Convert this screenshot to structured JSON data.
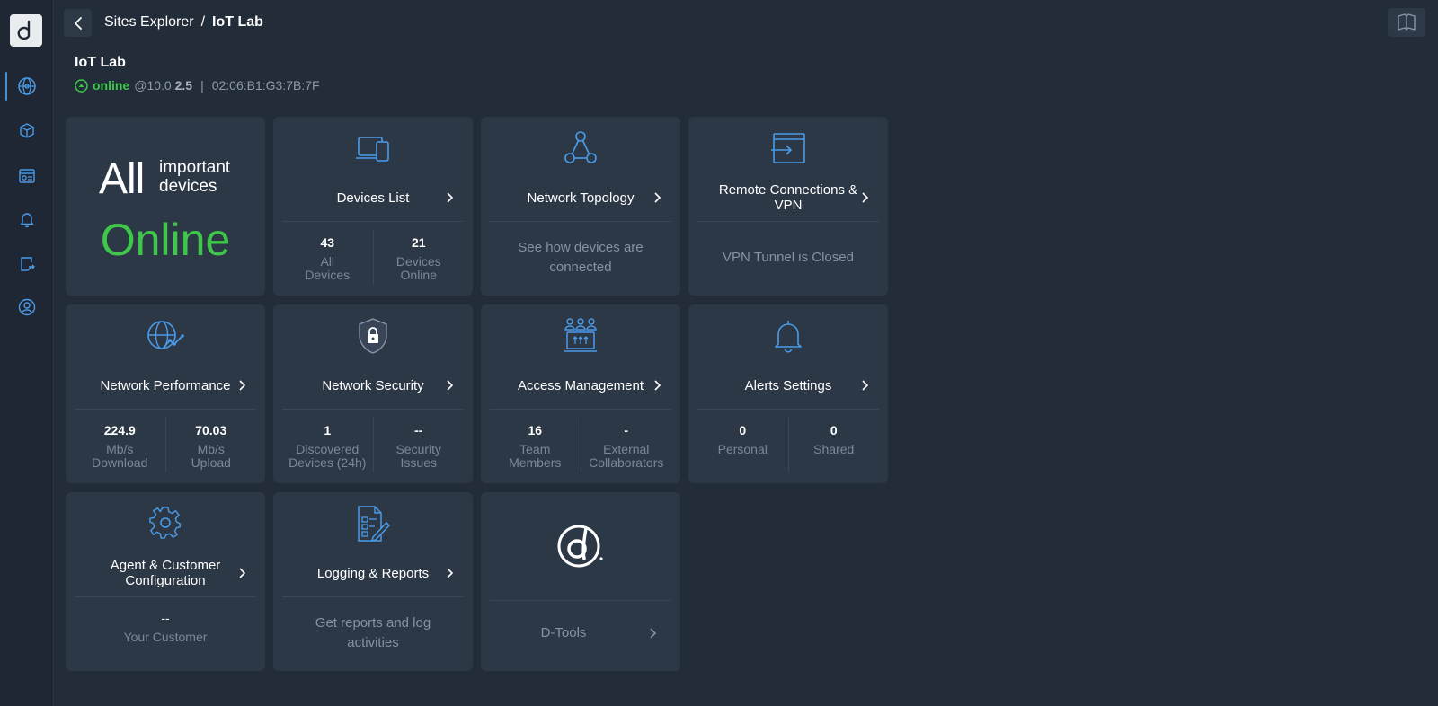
{
  "breadcrumb": {
    "parent": "Sites Explorer",
    "separator": "/",
    "current": "IoT Lab"
  },
  "site": {
    "title": "IoT Lab",
    "status": "online",
    "ip_prefix": "@10.0.",
    "ip_suffix": "2.5",
    "mac": "02:06:B1:G3:7B:7F"
  },
  "summary": {
    "big": "All",
    "small": "important devices",
    "state": "Online"
  },
  "cards": {
    "devices_list": {
      "label": "Devices List",
      "stat1_num": "43",
      "stat1_cap": "All Devices",
      "stat2_num": "21",
      "stat2_cap": "Devices Online"
    },
    "network_topology": {
      "label": "Network Topology",
      "desc": "See how devices are connected"
    },
    "remote_connections": {
      "label": "Remote Connections & VPN",
      "desc": "VPN Tunnel is Closed"
    },
    "network_performance": {
      "label": "Network Performance",
      "stat1_num": "224.9",
      "stat1_cap": "Mb/s Download",
      "stat2_num": "70.03",
      "stat2_cap": "Mb/s Upload"
    },
    "network_security": {
      "label": "Network Security",
      "stat1_num": "1",
      "stat1_cap": "Discovered Devices (24h)",
      "stat2_num": "--",
      "stat2_cap": "Security Issues"
    },
    "access_management": {
      "label": "Access Management",
      "stat1_num": "16",
      "stat1_cap": "Team Members",
      "stat2_num": "-",
      "stat2_cap": "External Collaborators"
    },
    "alerts_settings": {
      "label": "Alerts Settings",
      "stat1_num": "0",
      "stat1_cap": "Personal",
      "stat2_num": "0",
      "stat2_cap": "Shared"
    },
    "agent_config": {
      "label": "Agent & Customer Configuration",
      "stat1_num": "--",
      "stat1_cap": "Your Customer"
    },
    "logging_reports": {
      "label": "Logging & Reports",
      "desc": "Get reports and log activities"
    },
    "dtools": {
      "label": "D-Tools"
    }
  },
  "colors": {
    "accent": "#4a9be8",
    "online": "#3ec84a",
    "card": "#2d3846",
    "background": "#232c39"
  }
}
